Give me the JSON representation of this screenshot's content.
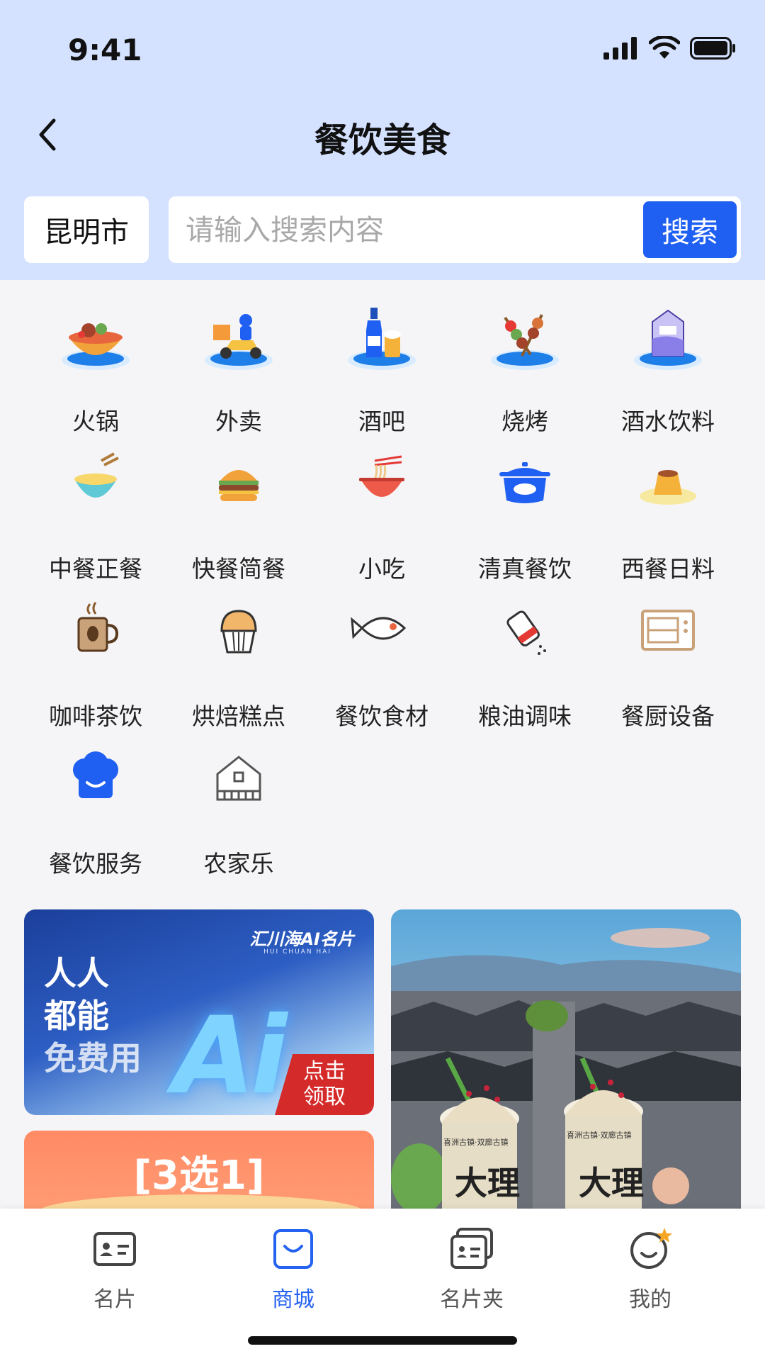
{
  "status_bar": {
    "time": "9:41"
  },
  "header": {
    "title": "餐饮美食",
    "city": "昆明市"
  },
  "search": {
    "placeholder": "请输入搜索内容",
    "button_label": "搜索"
  },
  "categories": [
    {
      "label": "火锅",
      "icon": "hotpot-icon"
    },
    {
      "label": "外卖",
      "icon": "delivery-scooter-icon"
    },
    {
      "label": "酒吧",
      "icon": "bottle-beer-icon"
    },
    {
      "label": "烧烤",
      "icon": "skewer-icon"
    },
    {
      "label": "酒水饮料",
      "icon": "milk-carton-icon"
    },
    {
      "label": "中餐正餐",
      "icon": "bowl-chopsticks-icon"
    },
    {
      "label": "快餐简餐",
      "icon": "burger-icon"
    },
    {
      "label": "小吃",
      "icon": "noodle-bowl-icon"
    },
    {
      "label": "清真餐饮",
      "icon": "roast-pot-icon"
    },
    {
      "label": "西餐日料",
      "icon": "pudding-icon"
    },
    {
      "label": "咖啡茶饮",
      "icon": "coffee-cup-icon"
    },
    {
      "label": "烘焙糕点",
      "icon": "muffin-icon"
    },
    {
      "label": "餐饮食材",
      "icon": "fish-icon"
    },
    {
      "label": "粮油调味",
      "icon": "salt-shaker-icon"
    },
    {
      "label": "餐厨设备",
      "icon": "oven-icon"
    },
    {
      "label": "餐饮服务",
      "icon": "chef-hat-icon"
    },
    {
      "label": "农家乐",
      "icon": "farmhouse-icon"
    }
  ],
  "banners": {
    "ai": {
      "brand": "汇川海AI名片",
      "brand_sub": "HUI CHUAN HAI",
      "slogan_1": "人人",
      "slogan_2": "都能",
      "slogan_3": "免费用",
      "ai_text": "Ai",
      "cta_1": "点击",
      "cta_2": "领取"
    },
    "pick": {
      "text": "[3选1]"
    },
    "dali": {
      "cup_text": "大理",
      "cup_sub": "喜洲古镇·双廊古镇"
    }
  },
  "bottom_nav": [
    {
      "label": "名片",
      "icon": "business-card-icon"
    },
    {
      "label": "商城",
      "icon": "shopping-bag-icon",
      "active": true
    },
    {
      "label": "名片夹",
      "icon": "card-holder-icon"
    },
    {
      "label": "我的",
      "icon": "smiley-profile-icon"
    }
  ],
  "colors": {
    "header_bg": "#d5e2ff",
    "accent": "#1f5ff2",
    "nav_active": "#2462f0",
    "cta_red": "#d52a2a"
  }
}
